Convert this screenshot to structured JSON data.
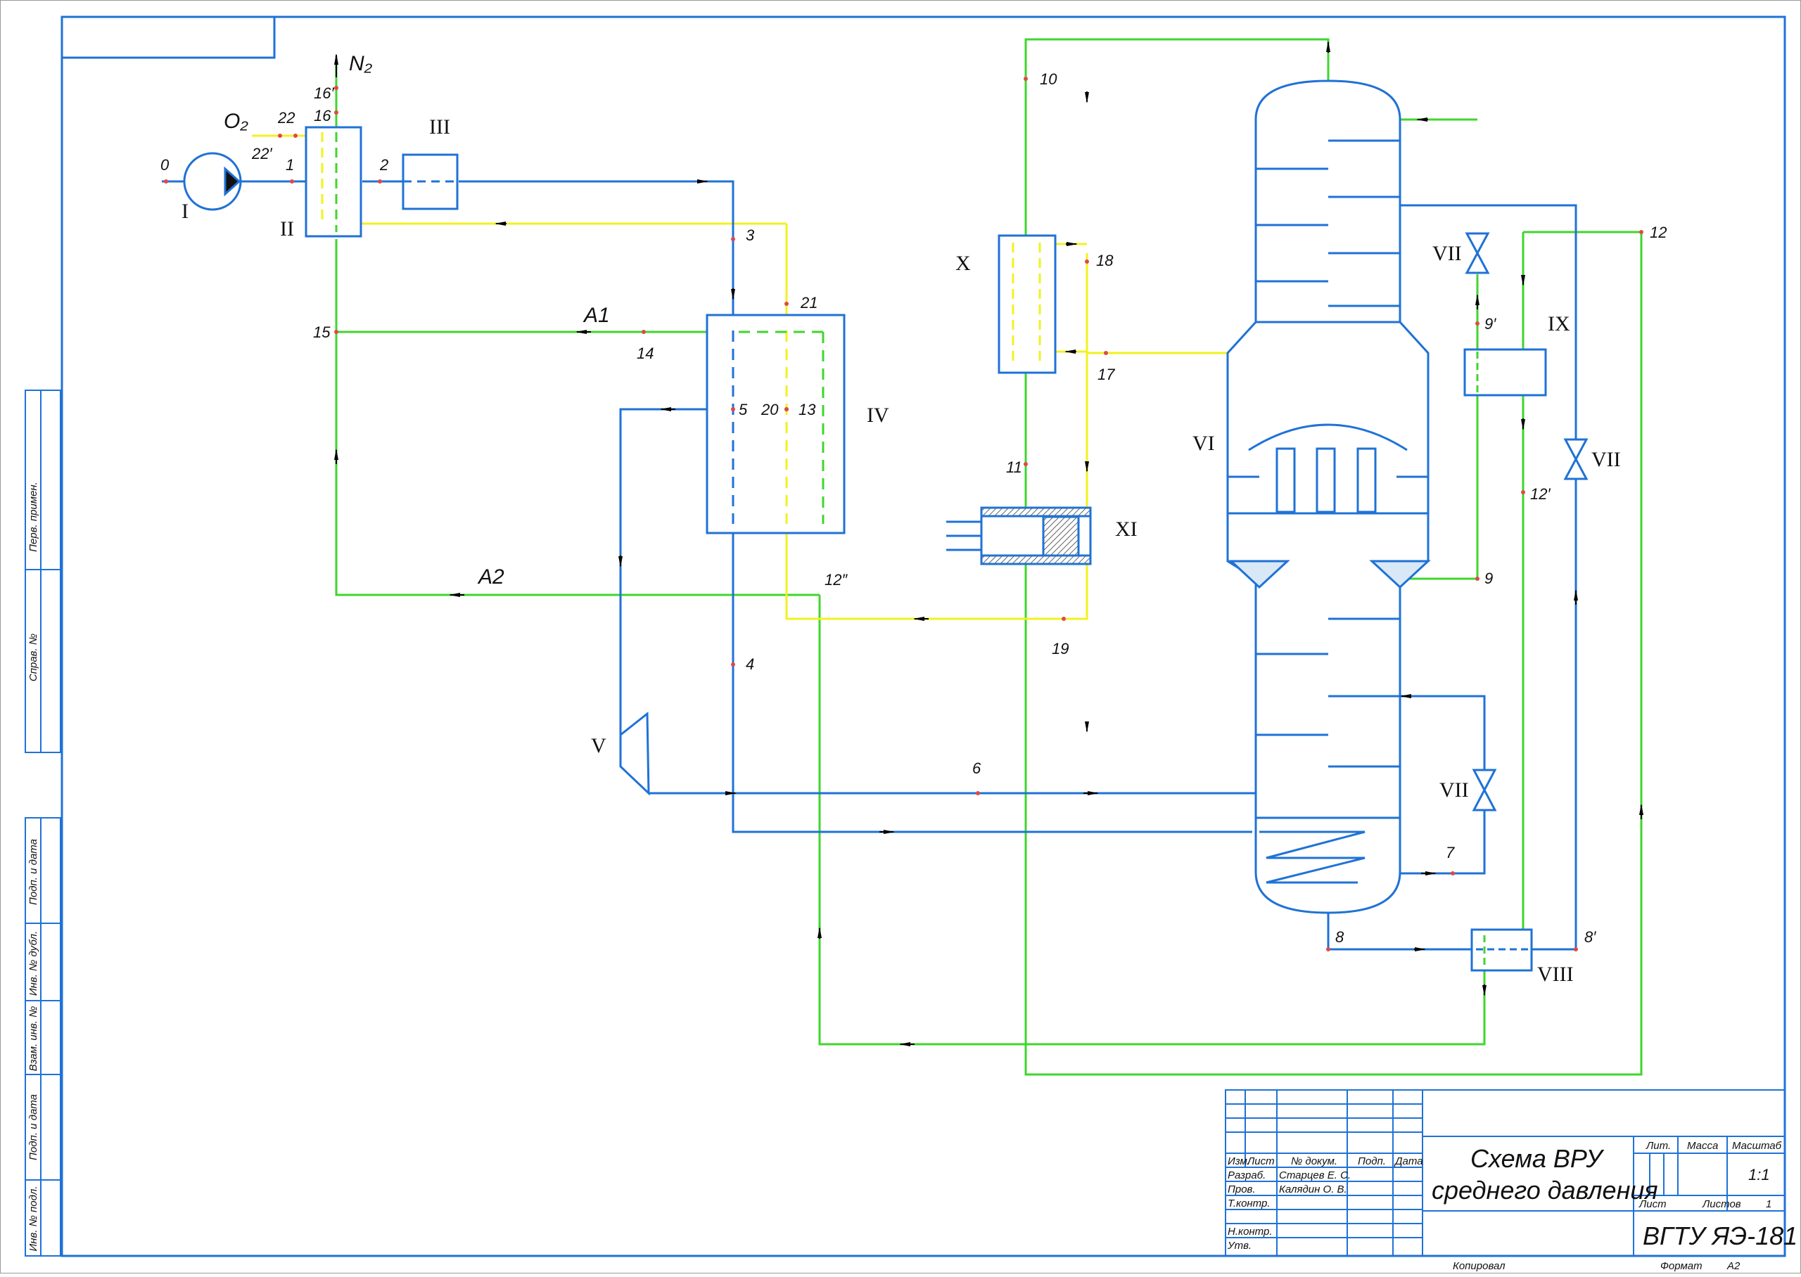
{
  "colors": {
    "blue": "#1f72d6",
    "green": "#3fd62e",
    "yellow": "#f2f21f",
    "frame": "#1f72d6",
    "point": "#e04848"
  },
  "streams": {
    "O2": "O₂",
    "N2": "N₂",
    "A1": "A1",
    "A2": "A2"
  },
  "points": {
    "p0": "0",
    "p1": "1",
    "p2": "2",
    "p3": "3",
    "p4": "4",
    "p5": "5",
    "p6": "6",
    "p7": "7",
    "p8": "8",
    "p8p": "8′",
    "p9": "9",
    "p9p": "9′",
    "p10": "10",
    "p11": "11",
    "p12": "12",
    "p12p": "12′",
    "p12pp": "12″",
    "p13": "13",
    "p14": "14",
    "p15": "15",
    "p16": "16",
    "p16p": "16′",
    "p17": "17",
    "p18": "18",
    "p19": "19",
    "p20": "20",
    "p21": "21",
    "p22": "22",
    "p22p": "22′"
  },
  "equipment": {
    "I": "I",
    "II": "II",
    "III": "III",
    "IV": "IV",
    "V": "V",
    "VI": "VI",
    "VII_a": "VII",
    "VII_b": "VII",
    "VII_c": "VII",
    "VIII": "VIII",
    "IX": "IX",
    "X": "X",
    "XI": "XI"
  },
  "margin_labels": {
    "perv_primen": "Перв. примен.",
    "sprav_no": "Справ. №",
    "podp_data_1": "Подп. и дата",
    "inv_dubl": "Инв. № дубл.",
    "vzam_inv": "Взам. инв. №",
    "podp_data_2": "Подп. и дата",
    "inv_podl": "Инв. № подл."
  },
  "title_block": {
    "col_izm": "Изм.",
    "col_list": "Лист",
    "col_doc": "№ докум.",
    "col_podp": "Подп.",
    "col_data": "Дата",
    "row_razrab": "Разраб.",
    "row_prov": "Пров.",
    "row_tkontr": "Т.контр.",
    "row_nkontr": "Н.контр.",
    "row_utv": "Утв.",
    "name_razrab": "Старцев Е. С.",
    "name_prov": "Калядин О. В.",
    "title_line1": "Схема ВРУ",
    "title_line2": "среднего давления",
    "lit_label": "Лит.",
    "massa_label": "Масса",
    "masshtab_label": "Масштаб",
    "scale_value": "1:1",
    "list_label": "Лист",
    "listov_label": "Листов",
    "listov_value": "1",
    "org": "ВГТУ ЯЭ-181",
    "kopiroval": "Копировал",
    "format_label": "Формат",
    "format_value": "А2"
  }
}
